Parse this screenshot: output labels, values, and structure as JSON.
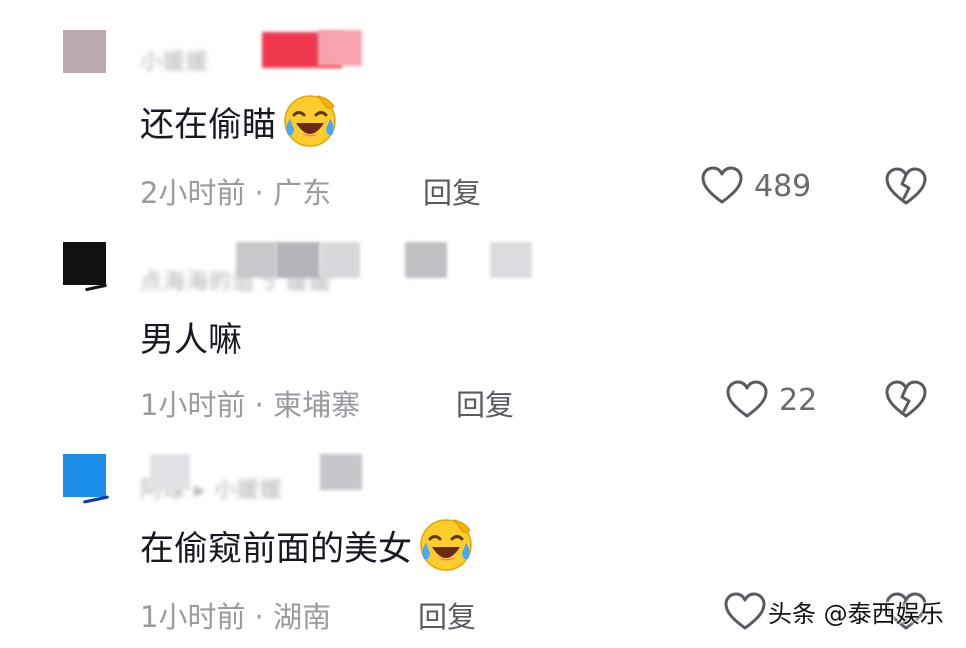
{
  "comments": [
    {
      "username": "小媛媛",
      "content": "还在偷瞄",
      "emoji": "laughing-crying-emoji",
      "time_location": "2小时前 · 广东",
      "reply_label": "回复",
      "like_count": "489"
    },
    {
      "username": "点海海的追ㄋ 媛媛",
      "content": "男人嘛",
      "emoji": "",
      "time_location": "1小时前 · 柬埔寨",
      "reply_label": "回复",
      "like_count": "22"
    },
    {
      "username": "阿球 ▸ 小媛媛",
      "content": "在偷窥前面的美女",
      "emoji": "laughing-crying-emoji",
      "time_location": "1小时前 · 湖南",
      "reply_label": "回复",
      "like_count": ""
    }
  ],
  "watermark": "头条 @泰西娱乐",
  "colors": {
    "text": "#161823",
    "meta": "#9a9aa1",
    "icon": "#5a5a63",
    "avatar_1": "#b09a9f",
    "avatar_2": "#111111",
    "avatar_3": "#1a8ee8",
    "red_badge": "#f0394f"
  }
}
